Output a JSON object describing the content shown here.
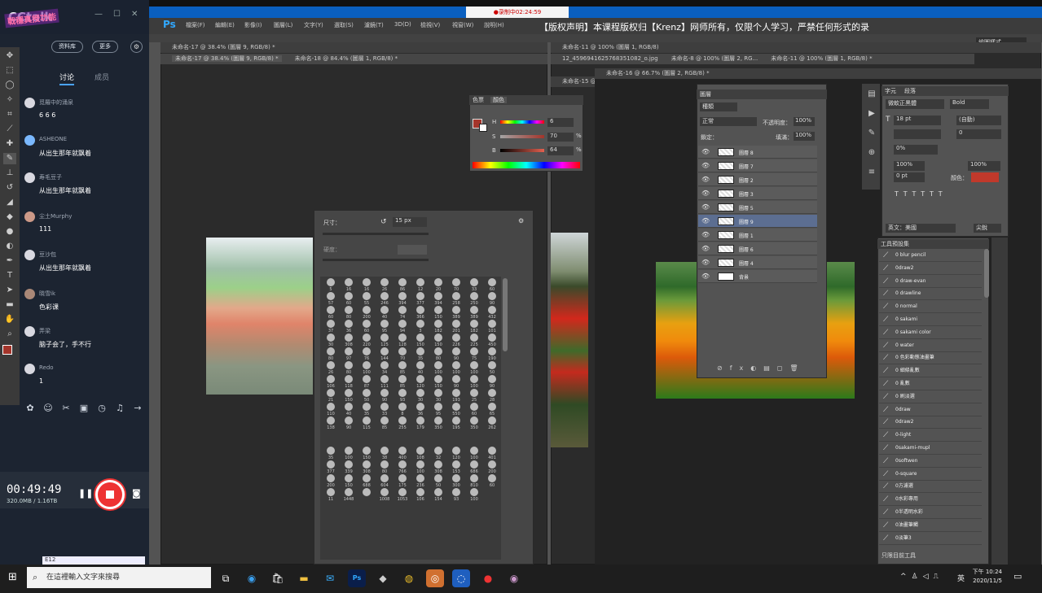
{
  "recording_badge": "●录制中02:24:59",
  "cctalk": {
    "logo": "CCtalk",
    "badge": "戰穩真授功能",
    "buttons": [
      "资料库",
      "更多"
    ],
    "tabs": [
      "讨论",
      "成员"
    ],
    "messages": [
      {
        "name": "觅羅中的涌泉",
        "text": "6 6 6"
      },
      {
        "name": "ASHEONE",
        "text": "从出生那年就飘着"
      },
      {
        "name": "寿毛豆子",
        "text": "从出生那年就飘着"
      },
      {
        "name": "尘土Murphy",
        "text": "111"
      },
      {
        "name": "豆沙包",
        "text": "从出生那年就飘着"
      },
      {
        "name": "晓雪ik",
        "text": "色彩课"
      },
      {
        "name": "弄梁",
        "text": "脑子会了，手不行"
      },
      {
        "name": "Redo",
        "text": "1"
      }
    ],
    "recording": {
      "time": "00:49:49",
      "size": "320.0MB / 1.16TB"
    },
    "bottom_field": "E12"
  },
  "ps": {
    "logo": "Ps",
    "menus": [
      "檔案(F)",
      "編輯(E)",
      "影像(I)",
      "圖層(L)",
      "文字(Y)",
      "選取(S)",
      "濾鏡(T)",
      "3D(D)",
      "檢視(V)",
      "視窗(W)",
      "說明(H)"
    ],
    "banner": "【版权声明】本课程版权归【Krenz】网师所有，仅限个人学习，严禁任何形式的录",
    "workspace": "繪圖樣式",
    "doc_tabs_left": [
      "未命名-17 @ 38.4% (圖層 9, RGB/8) *",
      "未命名-18 @ 84.4% (圖層 1, RGB/8) *"
    ],
    "doc_tabs_right": [
      "未命名-11 @ 100% (圖層 1, RGB/8)",
      "12_4596941625768351082_o.jpg",
      "未命名-8 @ 100% (圖層 2, RG...",
      "未命名-11 @ 100% (圖層 1, RGB/8) *"
    ],
    "doc16": "未命名-16 @ 66.7% (圖層 2, RGB/8) *",
    "doc15": "未命名-15 @",
    "color_panel": {
      "tabs": [
        "色票",
        "顏色"
      ],
      "H": "6",
      "S": "70",
      "B": "64",
      "pct": "%",
      "swatch": "#a4352b"
    },
    "brush_panel": {
      "size_label": "尺寸：",
      "size_value": "15 px",
      "hardness_label": "硬度："
    },
    "brush_sizes": [
      "5",
      "16",
      "16",
      "26",
      "86",
      "12",
      "20",
      "70",
      "33",
      "60",
      "57",
      "60",
      "55",
      "246",
      "394",
      "377",
      "394",
      "258",
      "250",
      "90",
      "60",
      "80",
      "200",
      "40",
      "74",
      "366",
      "150",
      "389",
      "389",
      "432",
      "37",
      "36",
      "60",
      "95",
      "94",
      "3",
      "182",
      "201",
      "182",
      "101",
      "30",
      "308",
      "220",
      "125",
      "128",
      "150",
      "150",
      "226",
      "225",
      "450",
      "80",
      "97",
      "76",
      "144",
      "70",
      "35",
      "80",
      "90",
      "75",
      "190",
      "26",
      "80",
      "100",
      "34",
      "85",
      "40",
      "100",
      "100",
      "100",
      "50",
      "106",
      "118",
      "87",
      "111",
      "85",
      "120",
      "150",
      "90",
      "100",
      "90",
      "21",
      "150",
      "50",
      "90",
      "93",
      "30",
      "30",
      "193",
      "25",
      "28",
      "110",
      "40",
      "35",
      "33",
      "8",
      "36",
      "95",
      "550",
      "60",
      "65",
      "138",
      "90",
      "115",
      "85",
      "255",
      "179",
      "350",
      "195",
      "350",
      "262",
      "35",
      "100",
      "150",
      "38",
      "400",
      "108",
      "32",
      "120",
      "100",
      "401",
      "377",
      "339",
      "308",
      "80",
      "766",
      "100",
      "308",
      "153",
      "686",
      "200",
      "200",
      "150",
      "688",
      "604",
      "175",
      "236",
      "50",
      "300",
      "810",
      "60",
      "11",
      "1448",
      "",
      "1008",
      "1053",
      "106",
      "154",
      "93",
      "100"
    ],
    "layers_panel": {
      "title": "圖層",
      "filter": "種類",
      "mode": "正常",
      "opacity_label": "不透明度：",
      "opacity": "100%",
      "lock_label": "鎖定：",
      "fill_label": "填滿：",
      "fill": "100%",
      "layers": [
        {
          "name": "圖層 8",
          "selected": false
        },
        {
          "name": "圖層 7",
          "selected": false
        },
        {
          "name": "圖層 2",
          "selected": false
        },
        {
          "name": "圖層 3",
          "selected": false
        },
        {
          "name": "圖層 5",
          "selected": false
        },
        {
          "name": "圖層 9",
          "selected": true
        },
        {
          "name": "圖層 1",
          "selected": false
        },
        {
          "name": "圖層 6",
          "selected": false
        },
        {
          "name": "圖層 4",
          "selected": false
        },
        {
          "name": "背景",
          "selected": false
        }
      ]
    },
    "char_panel": {
      "tabs": [
        "字元",
        "段落"
      ],
      "font": "微軟正黑體",
      "style": "Bold",
      "size": "18 pt",
      "leading": "(自動)",
      "kerning": "0",
      "tracking": "0%",
      "vscale": "100%",
      "hscale": "100%",
      "baseline": "0 pt",
      "color_label": "顏色：",
      "lang": "英文：美國",
      "aa": "尖銳"
    },
    "tool_presets": {
      "title": "工具預設集",
      "items": [
        "0 blur pencil",
        "0draw2",
        "0 draw-evan",
        "0 drawline",
        "0 normal",
        "0 sakami",
        "0 sakami color",
        "0 water",
        "0 色彩動態油畫筆",
        "0 細條亂數",
        "0 亂數",
        "0 刷淡選",
        "0draw",
        "0draw2",
        "0-light",
        "0sakami-mupl",
        "0softwen",
        "0-square",
        "0方濾選",
        "0水彩專用",
        "0半透明水彩",
        "0油畫筆觸",
        "0淡筆3"
      ],
      "current_only": "只限目前工具"
    }
  },
  "taskbar": {
    "search": "在這裡輸入文字來搜尋",
    "ime": "英",
    "time": "下午 10:24",
    "date": "2020/11/5"
  }
}
